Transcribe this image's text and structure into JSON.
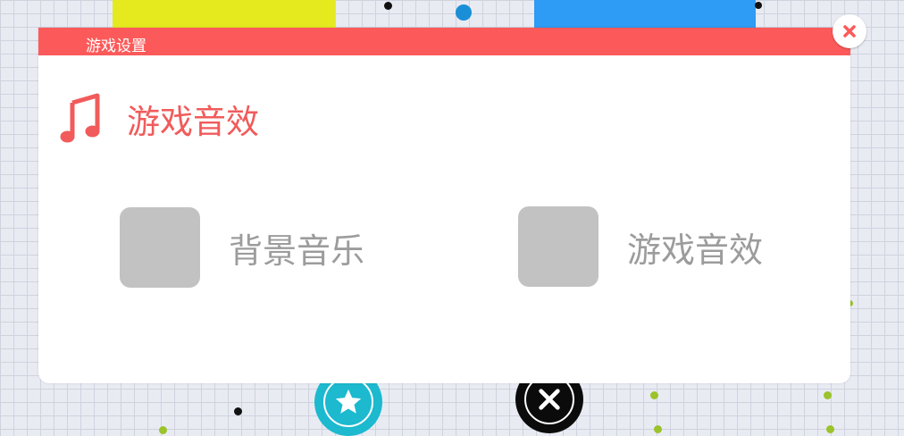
{
  "dialog": {
    "title": "游戏设置",
    "section_title": "游戏音效",
    "section_icon": "music-note-icon",
    "options": [
      {
        "label": "背景音乐",
        "checked": false
      },
      {
        "label": "游戏音效",
        "checked": false
      }
    ],
    "close_icon": "close-icon"
  },
  "colors": {
    "accent": "#fc5a5a",
    "section_title": "#f15b5b",
    "checkbox": "#c2c2c2",
    "option_text": "#9c9c9c",
    "background": "#e9ebf3",
    "star_button": "#1cb9cf",
    "close_game_button": "#0b0b0b",
    "yellow_block": "#e4ea1e",
    "blue_block": "#2e9bf4"
  },
  "background_buttons": {
    "star_icon": "star-icon",
    "x_icon": "x-icon"
  }
}
